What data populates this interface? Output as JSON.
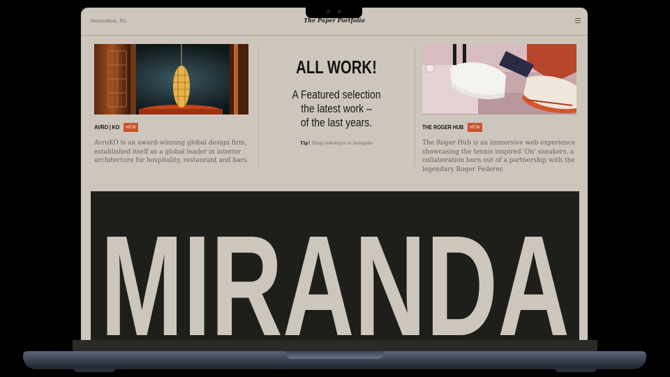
{
  "site": {
    "location": "Amsterdam, NL",
    "title": "The Paper Portfolio"
  },
  "projects": [
    {
      "name": "AVRO | KO",
      "badge": "NEW",
      "description": "AvroKO is an award-winning global design firm, established itself as a global leader in interior architecture for hospitality, restaurant and bars."
    },
    {
      "name": "THE ROGER HUB",
      "badge": "NEW",
      "description": "The Roger Hub is an immersive web experience showcasing the tennis inspired 'On' sneakers, a collaboration born out of a partnership with the legendary Roger Federer."
    }
  ],
  "intro": {
    "heading": "ALL WORK!",
    "subtitle_line1": "A Featured selection",
    "subtitle_line2": "the latest work –",
    "subtitle_line3": "of the last years.",
    "tip_label": "Tip!",
    "tip_text": " Drag sideways to navigate"
  },
  "banner": {
    "word": "MIRANDA"
  },
  "colors": {
    "page_bg": "#cdc6bd",
    "banner_bg": "#1e1e1a",
    "badge": "#c9522c",
    "ink": "#141311"
  },
  "icons": {
    "menu": "hamburger-icon"
  }
}
